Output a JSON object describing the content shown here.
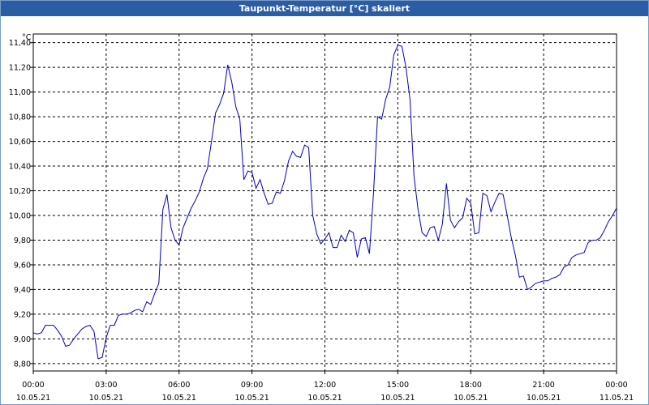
{
  "window": {
    "title": "Taupunkt-Temperatur [°C] skaliert"
  },
  "colors": {
    "titlebar": "#2a5da3",
    "line": "#0000c0",
    "grid": "#000000"
  },
  "chart_data": {
    "type": "line",
    "title": "Taupunkt-Temperatur [°C] skaliert",
    "ylabel": "°C",
    "xlabel": "",
    "ylim": [
      8.74,
      11.47
    ],
    "xlim": [
      "10.05.21 00:00",
      "11.05.21 00:00"
    ],
    "grid": true,
    "legend": "none",
    "y_ticks": [
      "8,80",
      "9,00",
      "9,20",
      "9,40",
      "9,60",
      "9,80",
      "10,00",
      "10,20",
      "10,40",
      "10,60",
      "10,80",
      "11,00",
      "11,20",
      "11,40"
    ],
    "x_ticks": [
      {
        "time": "00:00",
        "date": "10.05.21"
      },
      {
        "time": "03:00",
        "date": "10.05.21"
      },
      {
        "time": "06:00",
        "date": "10.05.21"
      },
      {
        "time": "09:00",
        "date": "10.05.21"
      },
      {
        "time": "12:00",
        "date": "10.05.21"
      },
      {
        "time": "15:00",
        "date": "10.05.21"
      },
      {
        "time": "18:00",
        "date": "10.05.21"
      },
      {
        "time": "21:00",
        "date": "10.05.21"
      },
      {
        "time": "00:00",
        "date": "11.05.21"
      }
    ],
    "series": [
      {
        "x": [
          "00:00",
          "00:10",
          "00:20",
          "00:30",
          "00:40",
          "00:50",
          "01:00",
          "01:10",
          "01:20",
          "01:30",
          "01:40",
          "01:50",
          "02:00",
          "02:10",
          "02:20",
          "02:30",
          "02:40",
          "02:50",
          "03:00",
          "03:10",
          "03:20",
          "03:30",
          "03:40",
          "03:50",
          "04:00",
          "04:10",
          "04:20",
          "04:30",
          "04:40",
          "04:50",
          "05:00",
          "05:10",
          "05:20",
          "05:30",
          "05:40",
          "05:50",
          "06:00",
          "06:10",
          "06:20",
          "06:30",
          "06:40",
          "06:50",
          "07:00",
          "07:10",
          "07:20",
          "07:30",
          "07:40",
          "07:50",
          "08:00",
          "08:10",
          "08:20",
          "08:30",
          "08:40",
          "08:50",
          "09:00",
          "09:10",
          "09:20",
          "09:30",
          "09:40",
          "09:50",
          "10:00",
          "10:10",
          "10:20",
          "10:30",
          "10:40",
          "10:50",
          "11:00",
          "11:10",
          "11:20",
          "11:30",
          "11:40",
          "11:50",
          "12:00",
          "12:10",
          "12:20",
          "12:30",
          "12:40",
          "12:50",
          "13:00",
          "13:10",
          "13:20",
          "13:30",
          "13:40",
          "13:50",
          "14:00",
          "14:10",
          "14:20",
          "14:30",
          "14:40",
          "14:50",
          "15:00",
          "15:10",
          "15:20",
          "15:30",
          "15:40",
          "15:50",
          "16:00",
          "16:10",
          "16:20",
          "16:30",
          "16:40",
          "16:50",
          "17:00",
          "17:10",
          "17:20",
          "17:30",
          "17:40",
          "17:50",
          "18:00",
          "18:10",
          "18:20",
          "18:30",
          "18:40",
          "18:50",
          "19:00",
          "19:10",
          "19:20",
          "19:30",
          "19:40",
          "19:50",
          "20:00",
          "20:10",
          "20:20",
          "20:30",
          "20:40",
          "20:50",
          "21:00",
          "21:10",
          "21:20",
          "21:30",
          "21:40",
          "21:50",
          "22:00",
          "22:10",
          "22:20",
          "22:30",
          "22:40",
          "22:50",
          "23:00",
          "23:10",
          "23:20",
          "23:30",
          "23:40",
          "23:50",
          "24:00"
        ],
        "values": [
          9.05,
          9.04,
          9.05,
          9.11,
          9.11,
          9.11,
          9.07,
          9.02,
          8.94,
          8.95,
          9.0,
          9.04,
          9.08,
          9.1,
          9.11,
          9.06,
          8.84,
          8.85,
          9.01,
          9.11,
          9.11,
          9.19,
          9.2,
          9.2,
          9.21,
          9.23,
          9.24,
          9.22,
          9.3,
          9.28,
          9.37,
          9.45,
          10.05,
          10.17,
          9.9,
          9.8,
          9.76,
          9.9,
          9.98,
          10.06,
          10.12,
          10.19,
          10.3,
          10.38,
          10.6,
          10.83,
          10.9,
          10.99,
          11.22,
          11.08,
          10.88,
          10.78,
          10.29,
          10.36,
          10.35,
          10.22,
          10.29,
          10.18,
          10.09,
          10.1,
          10.19,
          10.18,
          10.28,
          10.44,
          10.52,
          10.48,
          10.47,
          10.57,
          10.55,
          10.0,
          9.85,
          9.77,
          9.81,
          9.86,
          9.74,
          9.74,
          9.84,
          9.79,
          9.88,
          9.86,
          9.66,
          9.81,
          9.82,
          9.69,
          10.18,
          10.8,
          10.78,
          10.94,
          11.04,
          11.3,
          11.38,
          11.37,
          11.2,
          10.94,
          10.32,
          10.05,
          9.86,
          9.83,
          9.9,
          9.91,
          9.8,
          9.93,
          10.26,
          9.96,
          9.9,
          9.95,
          9.98,
          10.14,
          10.1,
          9.85,
          9.86,
          10.18,
          10.16,
          10.03,
          10.11,
          10.18,
          10.17,
          10.0,
          9.82,
          9.68,
          9.5,
          9.51,
          9.4,
          9.42,
          9.45,
          9.46,
          9.47,
          9.47,
          9.49,
          9.5,
          9.52,
          9.58,
          9.6,
          9.66,
          9.68,
          9.69,
          9.7,
          9.78,
          9.8,
          9.8,
          9.82,
          9.88,
          9.95,
          10.0,
          10.06
        ]
      }
    ]
  }
}
